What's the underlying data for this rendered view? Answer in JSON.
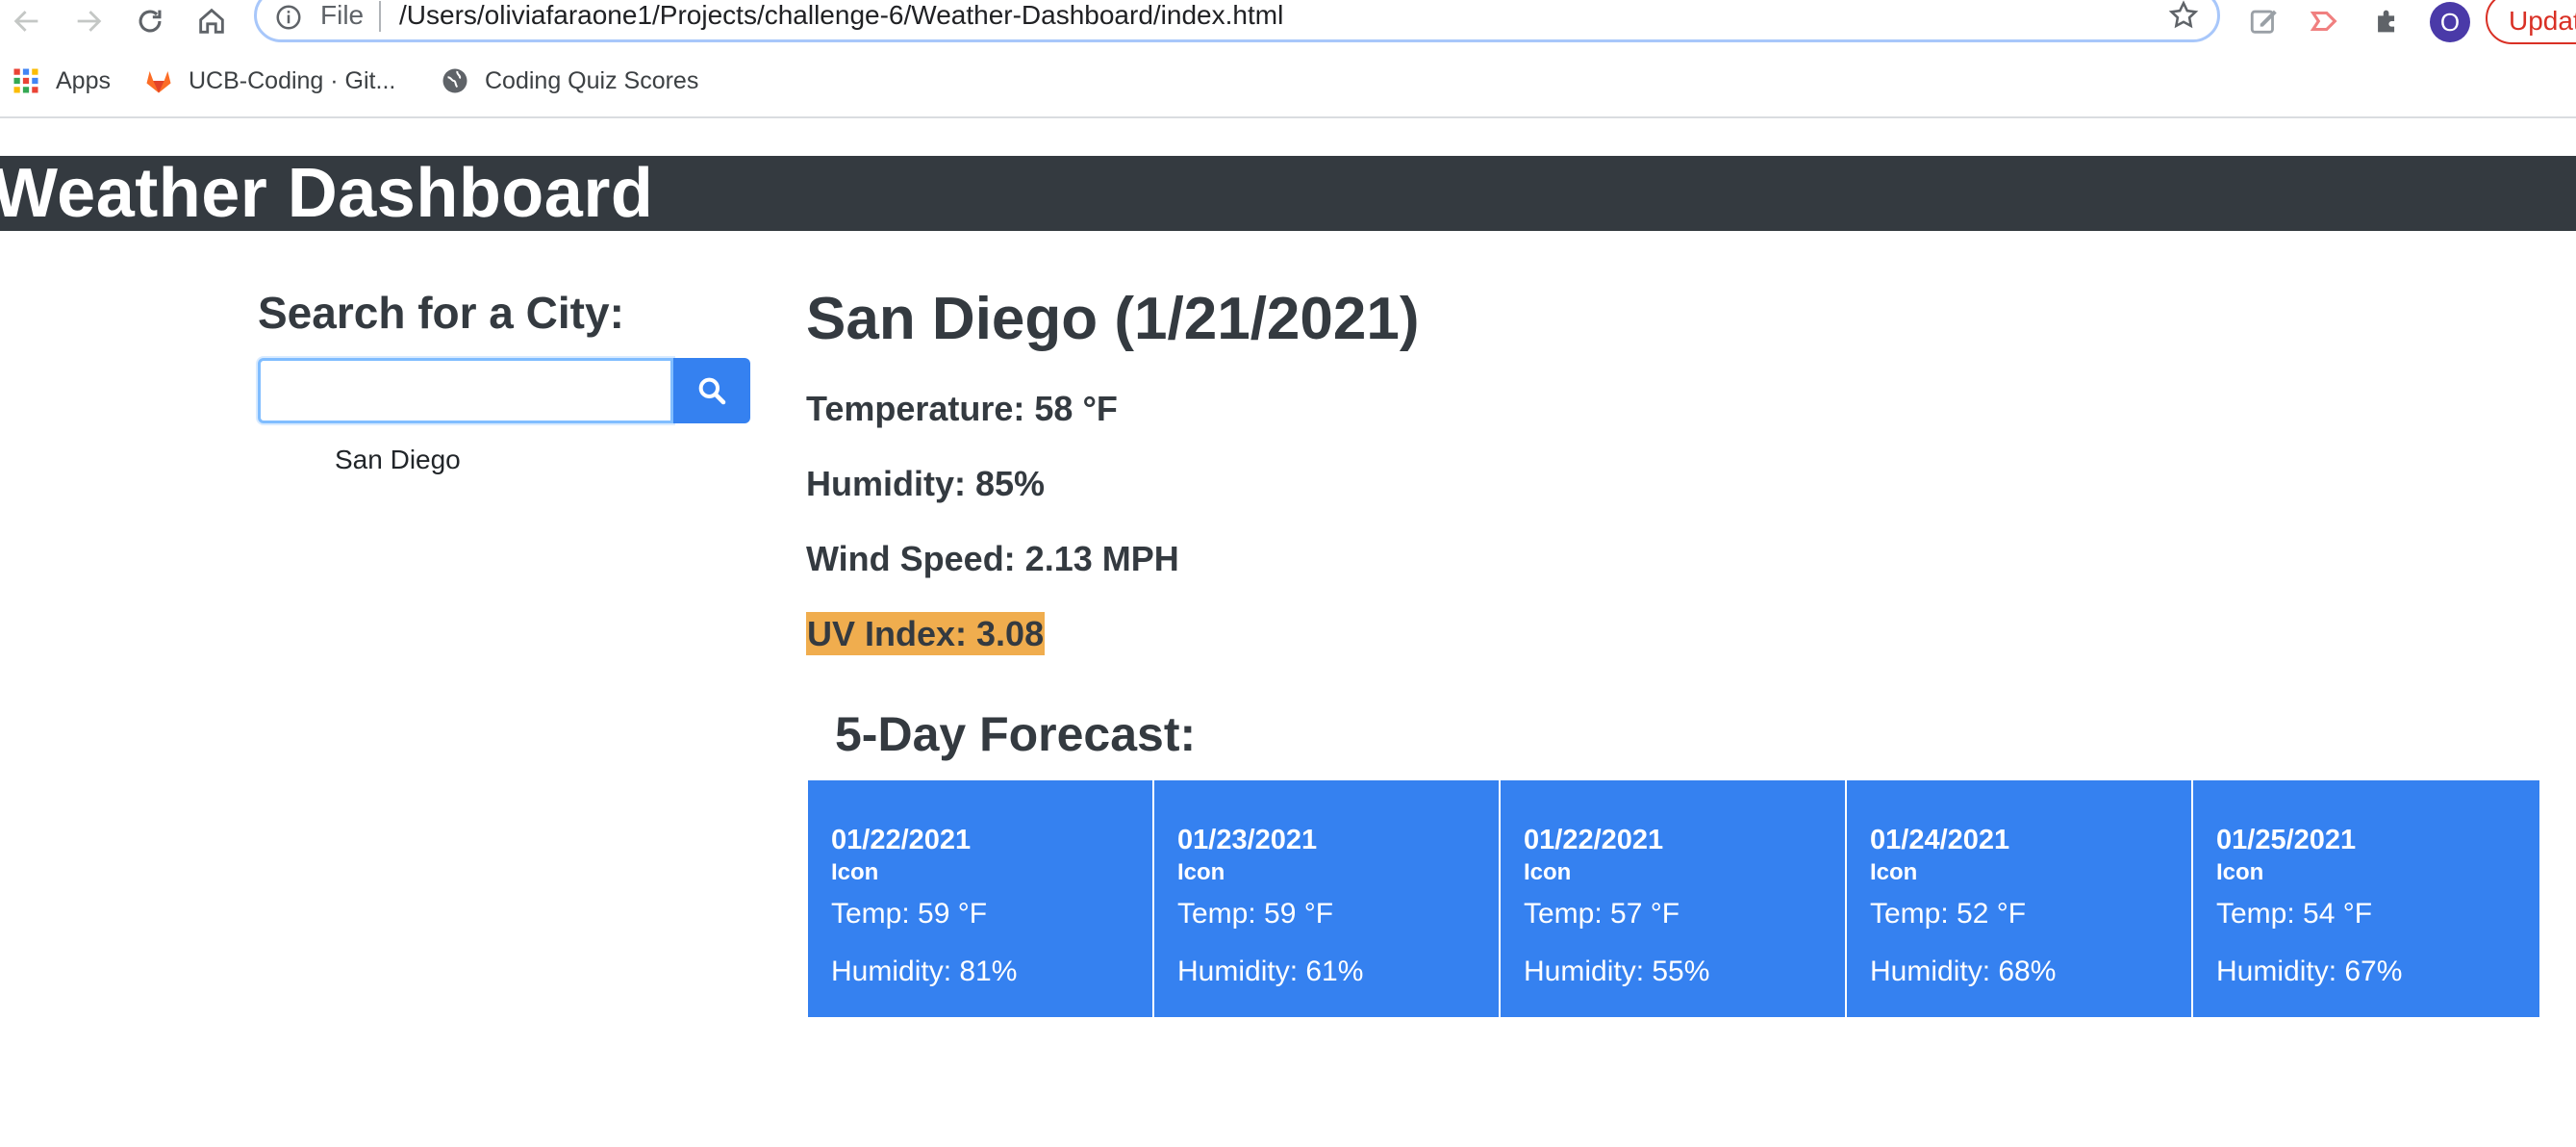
{
  "browser": {
    "scheme_label": "File",
    "url": "/Users/oliviafaraone1/Projects/challenge-6/Weather-Dashboard/index.html",
    "avatar_letter": "O",
    "update_label": "Update",
    "bookmarks": [
      {
        "label": "Apps",
        "icon": "apps-grid-icon"
      },
      {
        "label": "UCB-Coding · Git...",
        "icon": "gitlab-icon"
      },
      {
        "label": "Coding Quiz Scores",
        "icon": "globe-icon"
      }
    ]
  },
  "header": {
    "title": "Weather Dashboard",
    "background": "#343a40"
  },
  "search": {
    "heading": "Search for a City:",
    "input_value": "",
    "button_icon": "search-icon",
    "history": [
      "San Diego"
    ]
  },
  "current": {
    "title": "San Diego (1/21/2021)",
    "temperature": "Temperature: 58 °F",
    "humidity": "Humidity: 85%",
    "wind": "Wind Speed: 2.13 MPH",
    "uv": "UV Index: 3.08",
    "uv_color": "#f0ad4e"
  },
  "forecast": {
    "heading": "5-Day Forecast:",
    "card_color": "#3581f0",
    "days": [
      {
        "date": "01/22/2021",
        "icon": "Icon",
        "temp": "Temp: 59 °F",
        "humidity": "Humidity: 81%"
      },
      {
        "date": "01/23/2021",
        "icon": "Icon",
        "temp": "Temp: 59 °F",
        "humidity": "Humidity: 61%"
      },
      {
        "date": "01/22/2021",
        "icon": "Icon",
        "temp": "Temp: 57 °F",
        "humidity": "Humidity: 55%"
      },
      {
        "date": "01/24/2021",
        "icon": "Icon",
        "temp": "Temp: 52 °F",
        "humidity": "Humidity: 68%"
      },
      {
        "date": "01/25/2021",
        "icon": "Icon",
        "temp": "Temp: 54 °F",
        "humidity": "Humidity: 67%"
      }
    ]
  }
}
